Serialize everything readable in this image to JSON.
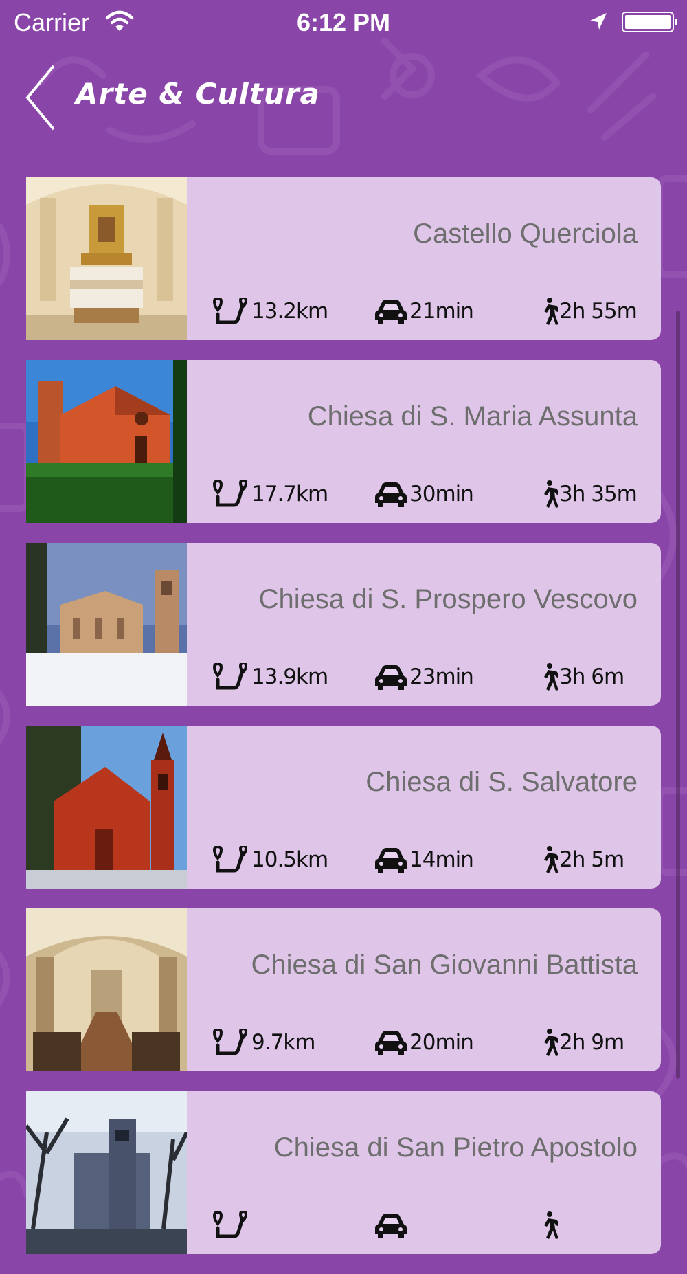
{
  "status_bar": {
    "carrier": "Carrier",
    "time": "6:12 PM"
  },
  "nav": {
    "title": "Arte & Cultura",
    "back_icon": "chevron-left-icon"
  },
  "colors": {
    "background": "#8a45a8",
    "card": "#e8d4f0",
    "title_text": "#6e6e6e"
  },
  "items": [
    {
      "title": "Castello Querciola",
      "distance": "13.2km",
      "drive": "21min",
      "walk": "2h 55m"
    },
    {
      "title": "Chiesa di S. Maria Assunta",
      "distance": "17.7km",
      "drive": "30min",
      "walk": "3h 35m"
    },
    {
      "title": "Chiesa di S. Prospero Vescovo",
      "distance": "13.9km",
      "drive": "23min",
      "walk": "3h 6m"
    },
    {
      "title": "Chiesa di S. Salvatore",
      "distance": "10.5km",
      "drive": "14min",
      "walk": "2h 5m"
    },
    {
      "title": "Chiesa di San Giovanni Battista",
      "distance": "9.7km",
      "drive": "20min",
      "walk": "2h 9m"
    },
    {
      "title": "Chiesa di San Pietro Apostolo",
      "distance": "",
      "drive": "",
      "walk": ""
    }
  ]
}
